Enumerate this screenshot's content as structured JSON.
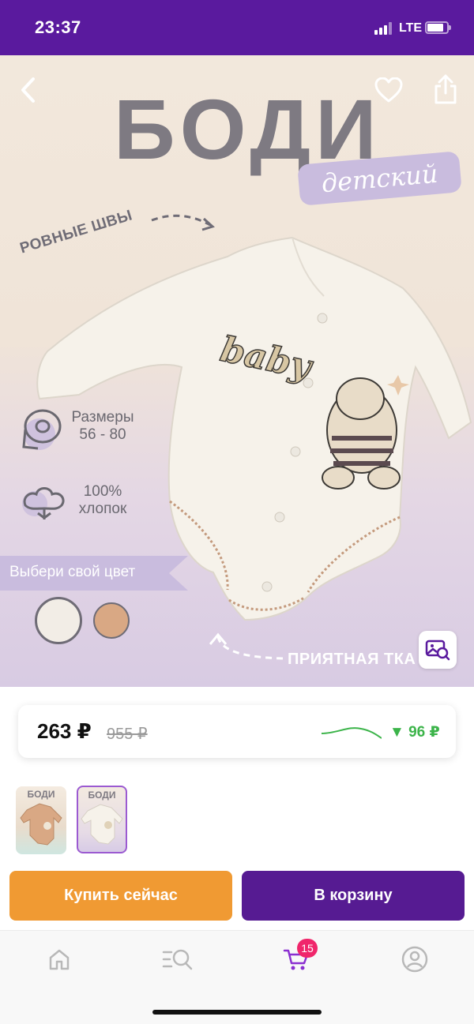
{
  "status_bar": {
    "time": "23:37",
    "network": "LTE"
  },
  "hero": {
    "title": "БОДИ",
    "subtitle": "детский",
    "seams_label": "РОВНЫЕ ШВЫ",
    "garment_print": "baby",
    "sizes_label": "Размеры",
    "sizes_value": "56 - 80",
    "cotton_percent": "100%",
    "cotton_label": "хлопок",
    "color_banner": "Выбери свой цвет",
    "fabric_label": "ПРИЯТНАЯ ТКА",
    "swatches": [
      "#f2ede6",
      "#d9a884"
    ],
    "icons": {
      "back": "chevron-left-icon",
      "favorite": "heart-icon",
      "share": "share-icon",
      "image_search": "image-search-icon"
    }
  },
  "price": {
    "current": "263 ₽",
    "old": "955 ₽",
    "drop": "▼ 96 ₽",
    "trend_color": "#3cb44a"
  },
  "thumbnails": [
    {
      "title": "БОДИ",
      "color": "#d9a884"
    },
    {
      "title": "БОДИ",
      "color": "#f2ede6"
    }
  ],
  "actions": {
    "buy_now": "Купить сейчас",
    "add_to_cart": "В корзину"
  },
  "tabbar": {
    "items": [
      "home-icon",
      "catalog-search-icon",
      "cart-icon",
      "profile-icon"
    ],
    "cart_count": "15"
  },
  "colors": {
    "brand": "#561b92",
    "accent": "#f09a33",
    "badge": "#f0266b"
  }
}
